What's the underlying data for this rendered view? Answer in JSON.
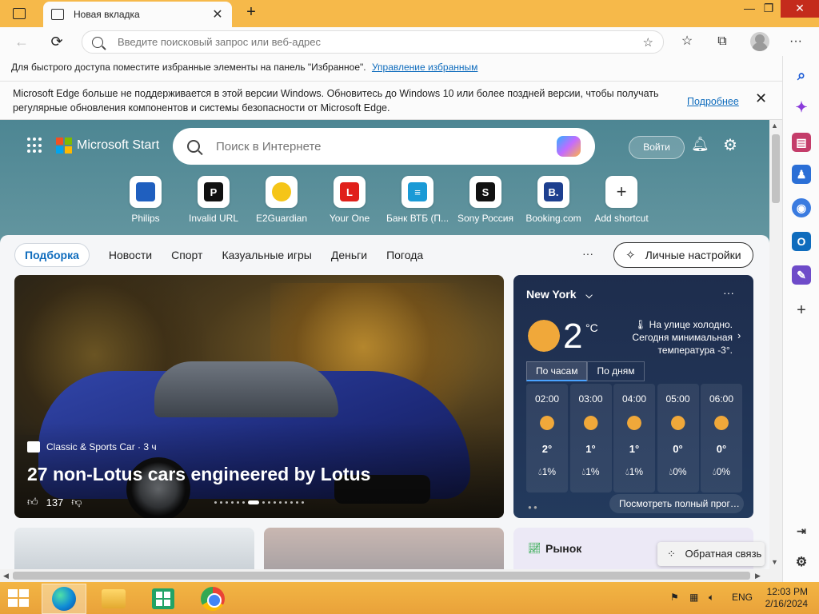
{
  "browser": {
    "tab": {
      "title": "Новая вкладка"
    },
    "window_controls": {
      "minimize": "—",
      "restore": "❐",
      "close": "✕"
    },
    "address": {
      "placeholder": "Введите поисковый запрос или веб-адрес"
    },
    "favorites_bar": {
      "text": "Для быстрого доступа поместите избранные элементы на панель \"Избранное\".",
      "link": "Управление избранным"
    },
    "infobar": {
      "message": "Microsoft Edge больше не поддерживается в этой версии Windows. Обновитесь до Windows 10 или более поздней версии, чтобы получать регулярные обновления компонентов и системы безопасности от Microsoft Edge.",
      "link": "Подробнее"
    }
  },
  "start_page": {
    "brand": "Microsoft Start",
    "search_placeholder": "Поиск в Интернете",
    "login": "Войти",
    "shortcuts": [
      {
        "label": "Philips",
        "glyph": "",
        "color": "#1f5fbf"
      },
      {
        "label": "Invalid URL",
        "glyph": "P",
        "color": "#111111"
      },
      {
        "label": "E2Guardian",
        "glyph": "",
        "color": "#f5c518"
      },
      {
        "label": "Your One",
        "glyph": "L",
        "color": "#e0201b"
      },
      {
        "label": "Банк ВТБ (П...",
        "glyph": "≡",
        "color": "#1a9ad6"
      },
      {
        "label": "Sony Россия",
        "glyph": "S",
        "color": "#111111"
      },
      {
        "label": "Booking.com",
        "glyph": "B.",
        "color": "#1d3f8f"
      },
      {
        "label": "Add shortcut",
        "glyph": "+",
        "color": "#ffffff"
      }
    ],
    "feed_nav": {
      "active": "Подборка",
      "items": [
        "Новости",
        "Спорт",
        "Казуальные игры",
        "Деньги",
        "Погода"
      ],
      "more": "···",
      "personalize": "Личные настройки"
    },
    "hero": {
      "source": "Classic & Sports Car · 3 ч",
      "headline": "27 non-Lotus cars engineered by Lotus",
      "likes": "137"
    },
    "weather": {
      "city": "New York",
      "menu": "···",
      "temp": "2",
      "unit": "°C",
      "note": "На улице холодно. Сегодня минимальная температура -3°.",
      "tabs": [
        "По часам",
        "По дням"
      ],
      "hours": [
        {
          "time": "02:00",
          "temp": "2°",
          "precip": "1%"
        },
        {
          "time": "03:00",
          "temp": "1°",
          "precip": "1%"
        },
        {
          "time": "04:00",
          "temp": "1°",
          "precip": "1%"
        },
        {
          "time": "05:00",
          "temp": "0°",
          "precip": "0%"
        },
        {
          "time": "06:00",
          "temp": "0°",
          "precip": "0%"
        }
      ],
      "full_forecast": "Посмотреть полный прогноз"
    },
    "market": {
      "title": "Рынок"
    },
    "feedback": "Обратная связь"
  },
  "taskbar": {
    "lang": "ENG",
    "time": "12:03 PM",
    "date": "2/16/2024"
  }
}
